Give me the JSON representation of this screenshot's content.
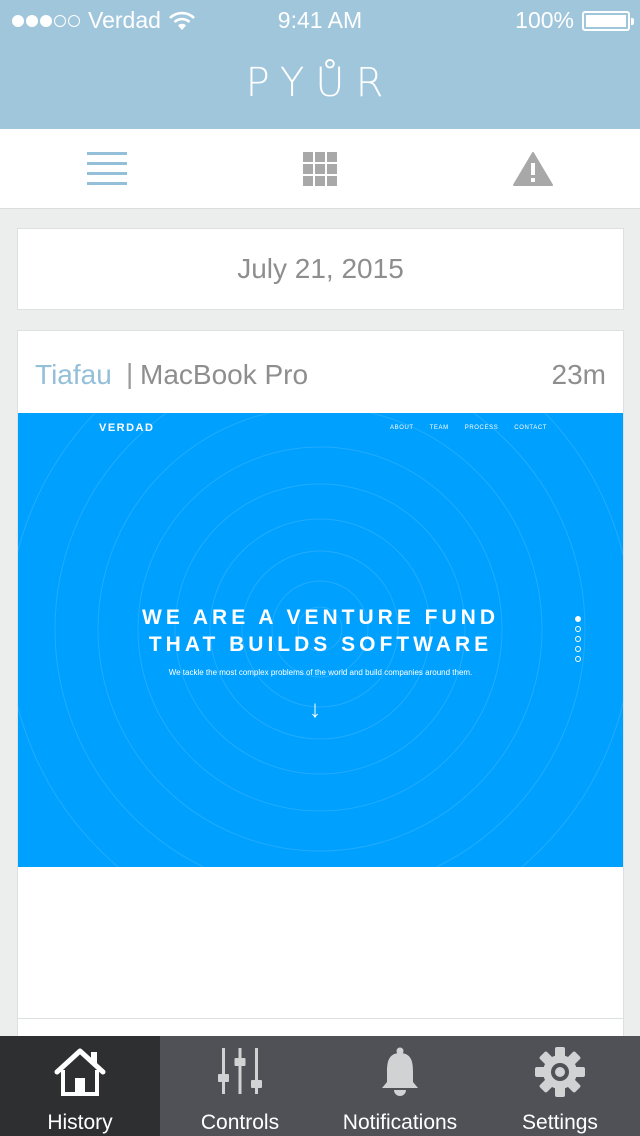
{
  "status_bar": {
    "carrier": "Verdad",
    "time": "9:41 AM",
    "battery": "100%",
    "signal_bars_filled": 3,
    "signal_bars_total": 5
  },
  "header": {
    "brand": "PYŮR"
  },
  "toolbar": {
    "items": [
      "list-icon",
      "grid-icon",
      "alert-icon"
    ],
    "active": "list-icon"
  },
  "history": {
    "date": "July 21, 2015",
    "entries": [
      {
        "user": "Tiafau",
        "separator": "|",
        "device": "MacBook Pro",
        "duration": "23m",
        "screenshot": {
          "logo": "VERDAD",
          "nav": [
            "ABOUT",
            "TEAM",
            "PROCESS",
            "CONTACT"
          ],
          "headline_1": "WE ARE A VENTURE FUND",
          "headline_2": "THAT BUILDS SOFTWARE",
          "tagline": "We tackle the most complex problems of the world and build companies around them.",
          "arrow": "↓",
          "pager_count": 5,
          "pager_active": 1,
          "background": "#00a0ff"
        }
      }
    ]
  },
  "tabbar": {
    "tabs": [
      {
        "label": "History",
        "icon": "home-icon",
        "active": true
      },
      {
        "label": "Controls",
        "icon": "sliders-icon",
        "active": false
      },
      {
        "label": "Notifications",
        "icon": "bell-icon",
        "active": false
      },
      {
        "label": "Settings",
        "icon": "gear-icon",
        "active": false
      }
    ]
  },
  "colors": {
    "header_bg": "#a0c6dc",
    "accent": "#93bfd9",
    "tabbar_bg": "#4f5157",
    "tabbar_active_bg": "#2e2f31",
    "page_bg": "#eceeee"
  }
}
